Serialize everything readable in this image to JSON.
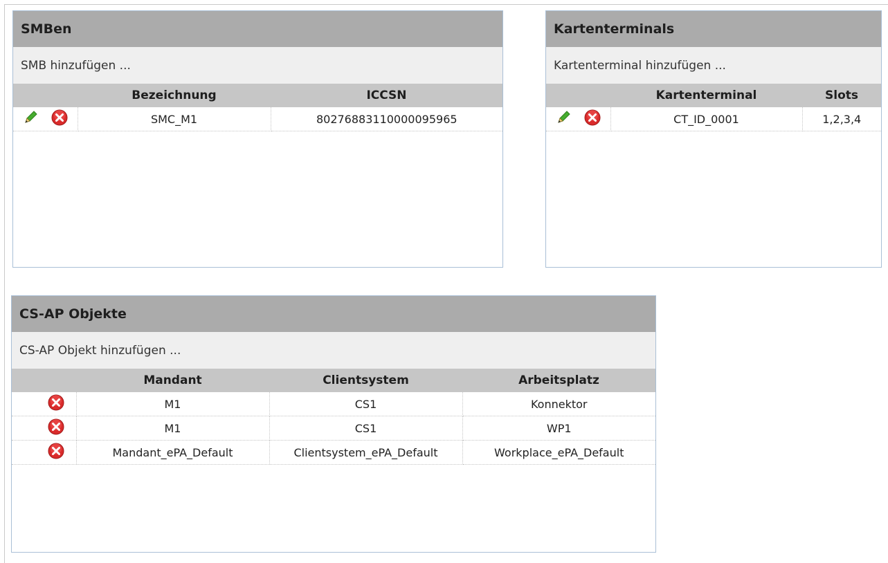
{
  "smb_panel": {
    "title": "SMBen",
    "add_label": "SMB hinzufügen ...",
    "columns": [
      "",
      "Bezeichnung",
      "ICCSN"
    ],
    "rows": [
      {
        "bezeichnung": "SMC_M1",
        "iccsn": "80276883110000095965"
      }
    ]
  },
  "ct_panel": {
    "title": "Kartenterminals",
    "add_label": "Kartenterminal hinzufügen ...",
    "columns": [
      "",
      "Kartenterminal",
      "Slots"
    ],
    "rows": [
      {
        "kartenterminal": "CT_ID_0001",
        "slots": "1,2,3,4"
      }
    ]
  },
  "csap_panel": {
    "title": "CS-AP Objekte",
    "add_label": "CS-AP Objekt hinzufügen ...",
    "columns": [
      "",
      "Mandant",
      "Clientsystem",
      "Arbeitsplatz"
    ],
    "rows": [
      {
        "mandant": "M1",
        "clientsystem": "CS1",
        "arbeitsplatz": "Konnektor"
      },
      {
        "mandant": "M1",
        "clientsystem": "CS1",
        "arbeitsplatz": "WP1"
      },
      {
        "mandant": "Mandant_ePA_Default",
        "clientsystem": "Clientsystem_ePA_Default",
        "arbeitsplatz": "Workplace_ePA_Default"
      }
    ]
  },
  "icons": {
    "edit": "pencil-icon",
    "delete": "delete-icon"
  },
  "colors": {
    "header_bg": "#ababab",
    "add_bar_bg": "#efefef",
    "column_header_bg": "#c6c6c6",
    "panel_border": "#a9bfd6",
    "delete_red": "#d92b2b",
    "edit_green": "#3fa52a"
  }
}
